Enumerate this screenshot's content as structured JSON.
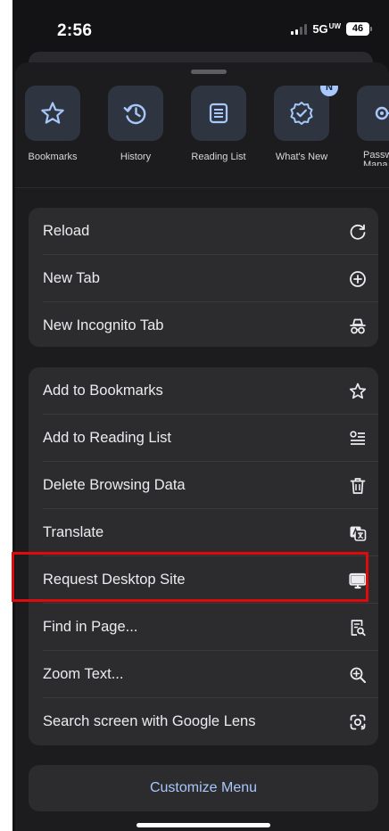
{
  "status_bar": {
    "time": "2:56",
    "network": "5G",
    "network_sub": "UW",
    "battery": "46"
  },
  "quick_actions": [
    {
      "label": "Bookmarks",
      "icon": "star-icon"
    },
    {
      "label": "History",
      "icon": "history-icon"
    },
    {
      "label": "Reading List",
      "icon": "reading-list-icon"
    },
    {
      "label": "What's New",
      "icon": "whats-new-icon",
      "badge": "N"
    },
    {
      "label": "Passw\nMana",
      "icon": "password-manager-icon"
    }
  ],
  "menu_group_1": [
    {
      "label": "Reload",
      "icon": "reload-icon"
    },
    {
      "label": "New Tab",
      "icon": "plus-circle-icon"
    },
    {
      "label": "New Incognito Tab",
      "icon": "incognito-icon"
    }
  ],
  "menu_group_2": [
    {
      "label": "Add to Bookmarks",
      "icon": "star-icon"
    },
    {
      "label": "Add to Reading List",
      "icon": "add-reading-list-icon"
    },
    {
      "label": "Delete Browsing Data",
      "icon": "trash-icon"
    },
    {
      "label": "Translate",
      "icon": "translate-icon"
    },
    {
      "label": "Request Desktop Site",
      "icon": "desktop-icon",
      "highlighted": true
    },
    {
      "label": "Find in Page...",
      "icon": "find-in-page-icon"
    },
    {
      "label": "Zoom Text...",
      "icon": "zoom-in-icon"
    },
    {
      "label": "Search screen with Google Lens",
      "icon": "google-lens-icon"
    }
  ],
  "customize_label": "Customize Menu",
  "colors": {
    "accent": "#a8c7fa",
    "highlight_border": "#e10a0a",
    "sheet": "#1c1c1e",
    "group": "#2c2c2e",
    "tile": "#2e3541"
  }
}
